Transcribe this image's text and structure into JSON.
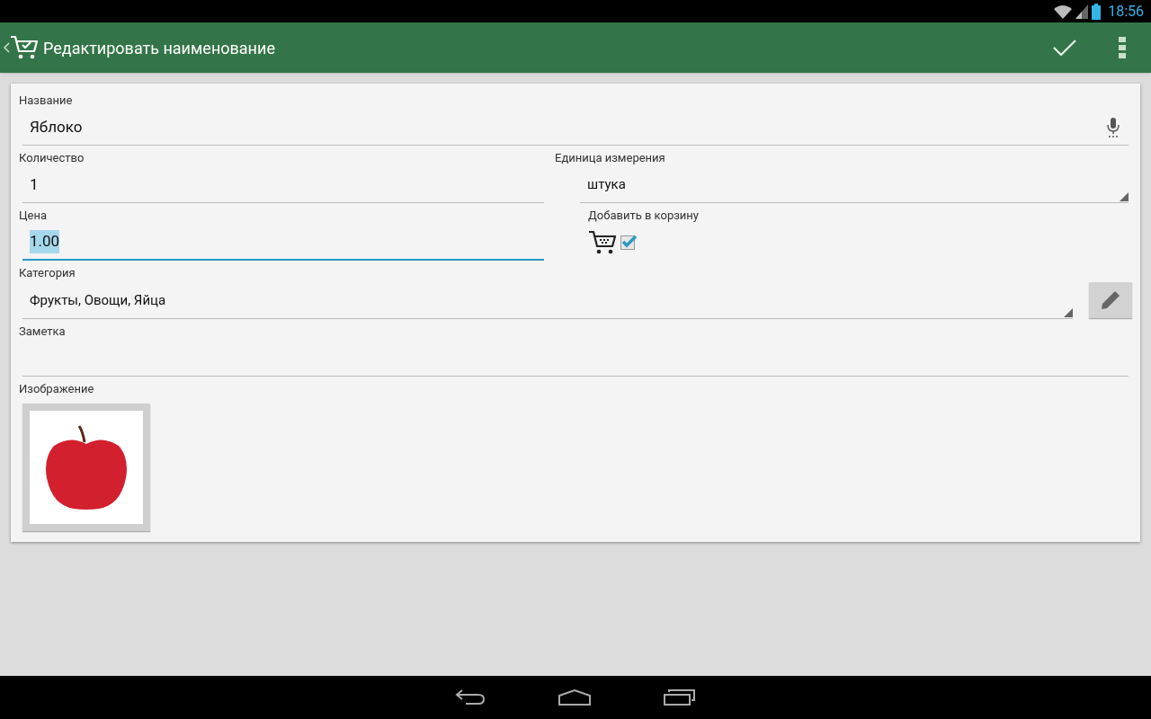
{
  "status_bar": {
    "time": "18:56"
  },
  "action_bar": {
    "title": "Редактировать наименование"
  },
  "form": {
    "name": {
      "label": "Название",
      "value": "Яблоко",
      "focused": false
    },
    "quantity": {
      "label": "Количество",
      "value": "1",
      "focused": false
    },
    "unit": {
      "label": "Единица измерения",
      "value": "штука"
    },
    "price": {
      "label": "Цена",
      "value": "1.00",
      "focused": true,
      "text_selected": true
    },
    "add_to_cart": {
      "label": "Добавить в корзину",
      "checked": true
    },
    "category": {
      "label": "Категория",
      "value": "Фрукты, Овощи, Яйца"
    },
    "note": {
      "label": "Заметка",
      "focused": false
    },
    "image": {
      "label": "Изображение"
    }
  }
}
